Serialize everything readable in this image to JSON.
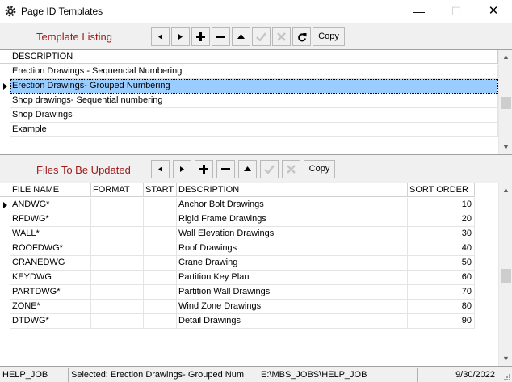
{
  "window": {
    "title": "Page ID Templates"
  },
  "templates": {
    "label": "Template Listing",
    "copy_label": "Copy",
    "column": "DESCRIPTION",
    "rows": [
      "Erection Drawings - Sequencial Numbering",
      "Erection Drawings- Grouped Numbering",
      "Shop drawings- Sequential numbering",
      "Shop Drawings",
      "Example"
    ],
    "selected_index": 1
  },
  "files": {
    "label": "Files To Be Updated",
    "copy_label": "Copy",
    "columns": [
      "FILE NAME",
      "FORMAT",
      "START",
      "DESCRIPTION",
      "SORT ORDER"
    ],
    "rows": [
      {
        "file": "ANDWG*",
        "format": "",
        "start": "",
        "desc": "Anchor Bolt Drawings",
        "order": "10"
      },
      {
        "file": "RFDWG*",
        "format": "",
        "start": "",
        "desc": "Rigid Frame Drawings",
        "order": "20"
      },
      {
        "file": "WALL*",
        "format": "",
        "start": "",
        "desc": "Wall Elevation Drawings",
        "order": "30"
      },
      {
        "file": "ROOFDWG*",
        "format": "",
        "start": "",
        "desc": "Roof Drawings",
        "order": "40"
      },
      {
        "file": "CRANEDWG",
        "format": "",
        "start": "",
        "desc": "Crane Drawing",
        "order": "50"
      },
      {
        "file": "KEYDWG",
        "format": "",
        "start": "",
        "desc": "Partition Key Plan",
        "order": "60"
      },
      {
        "file": "PARTDWG*",
        "format": "",
        "start": "",
        "desc": "Partition Wall Drawings",
        "order": "70"
      },
      {
        "file": "ZONE*",
        "format": "",
        "start": "",
        "desc": "Wind Zone Drawings",
        "order": "80"
      },
      {
        "file": "DTDWG*",
        "format": "",
        "start": "",
        "desc": "Detail Drawings",
        "order": "90"
      }
    ]
  },
  "status": {
    "job": "HELP_JOB",
    "selected": "Selected: Erection Drawings- Grouped Num",
    "path": "E:\\MBS_JOBS\\HELP_JOB",
    "date": "9/30/2022"
  }
}
